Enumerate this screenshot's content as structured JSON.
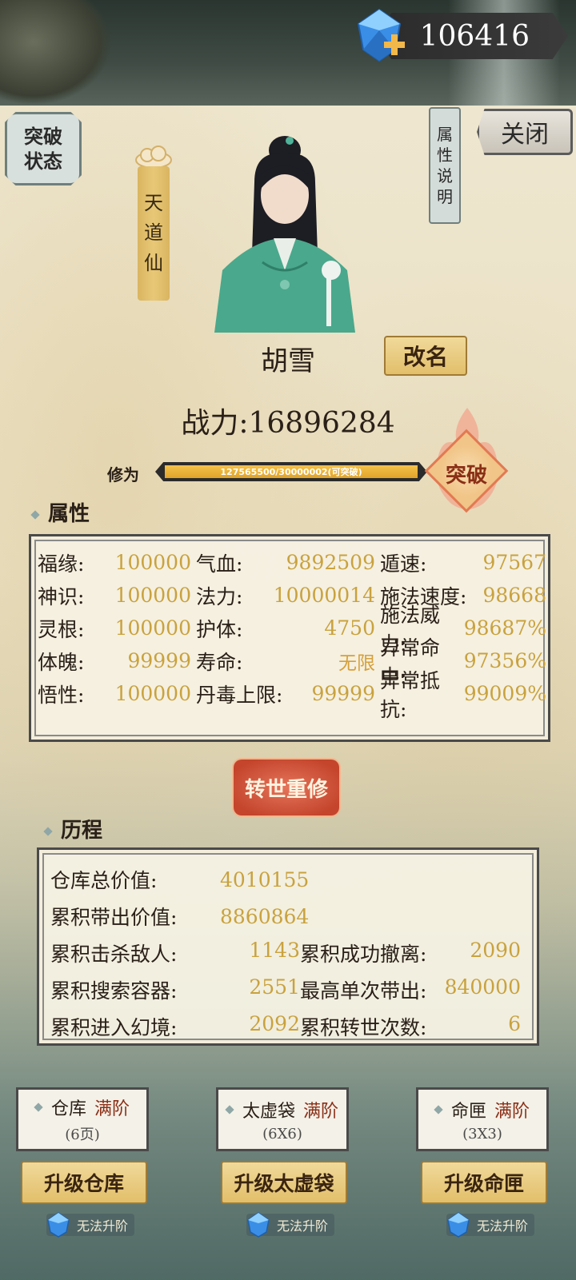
{
  "currency": {
    "value": "106416",
    "icon": "blue-gem-plus-icon"
  },
  "breakthrough_status_button": {
    "line1": "突破",
    "line2": "状态"
  },
  "title": {
    "chars": [
      "天",
      "道",
      "仙"
    ]
  },
  "attr_desc_button": {
    "chars": [
      "属",
      "性",
      "说",
      "明"
    ]
  },
  "close_button": {
    "label": "关闭"
  },
  "character": {
    "name": "胡雪",
    "rename_label": "改名",
    "power": "战力:16896284"
  },
  "cultivation": {
    "label": "修为",
    "progress_text": "127565500/30000002(可突破)",
    "progress_fraction": 1.0,
    "breakthrough_label": "突破"
  },
  "attributes": {
    "title": "属性",
    "rows": [
      [
        {
          "label": "福缘:",
          "value": "100000"
        },
        {
          "label": "气血:",
          "value": "9892509"
        },
        {
          "label": "遁速:",
          "value": "97567"
        }
      ],
      [
        {
          "label": "神识:",
          "value": "100000"
        },
        {
          "label": "法力:",
          "value": "10000014"
        },
        {
          "label": "施法速度:",
          "value": "98668"
        }
      ],
      [
        {
          "label": "灵根:",
          "value": "100000"
        },
        {
          "label": "护体:",
          "value": "4750"
        },
        {
          "label": "施法威力:",
          "value": "98687%"
        }
      ],
      [
        {
          "label": "体魄:",
          "value": "99999"
        },
        {
          "label": "寿命:",
          "value": "无限"
        },
        {
          "label": "异常命中:",
          "value": "97356%"
        }
      ],
      [
        {
          "label": "悟性:",
          "value": "100000"
        },
        {
          "label": "丹毒上限:",
          "value": "99999"
        },
        {
          "label": "异常抵抗:",
          "value": "99009%"
        }
      ]
    ]
  },
  "rebirth_button": {
    "label": "转世重修"
  },
  "history": {
    "title": "历程",
    "warehouse_value": {
      "label": "仓库总价值:",
      "value": "4010155"
    },
    "carried_value": {
      "label": "累积带出价值:",
      "value": "8860864"
    },
    "pairs": [
      [
        {
          "label": "累积击杀敌人:",
          "value": "1143"
        },
        {
          "label": "累积成功撤离:",
          "value": "2090"
        }
      ],
      [
        {
          "label": "累积搜索容器:",
          "value": "2551"
        },
        {
          "label": "最高单次带出:",
          "value": "840000"
        }
      ],
      [
        {
          "label": "累积进入幻境:",
          "value": "2092"
        },
        {
          "label": "累积转世次数:",
          "value": "6"
        }
      ]
    ]
  },
  "storage_cards": [
    {
      "name": "仓库",
      "status": "满阶",
      "sub": "(6页)",
      "upgrade": "升级仓库",
      "note": "无法升阶"
    },
    {
      "name": "太虚袋",
      "status": "满阶",
      "sub": "(6X6)",
      "upgrade": "升级太虚袋",
      "note": "无法升阶"
    },
    {
      "name": "命匣",
      "status": "满阶",
      "sub": "(3X3)",
      "upgrade": "升级命匣",
      "note": "无法升阶"
    }
  ]
}
